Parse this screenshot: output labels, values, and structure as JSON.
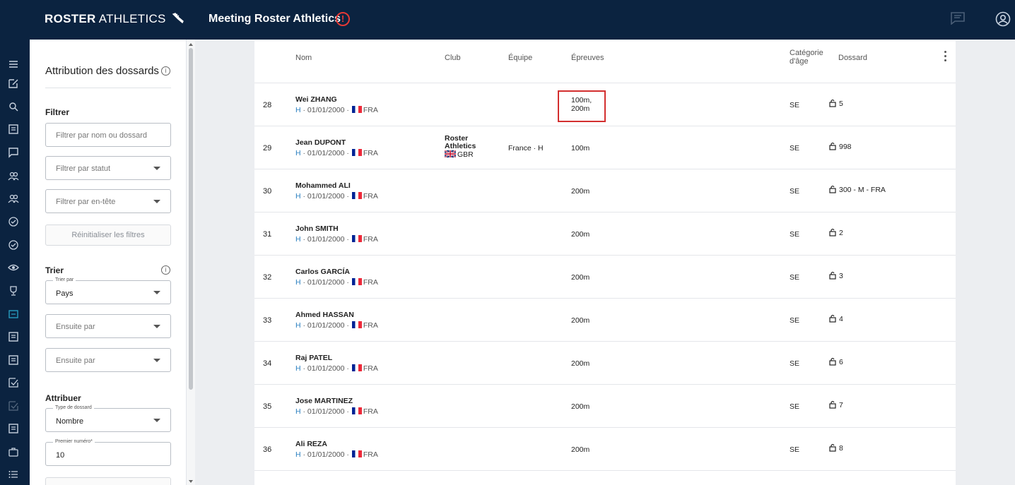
{
  "header": {
    "brand_bold": "ROSTER",
    "brand_light": "ATHLETICS",
    "meeting_title": "Meeting Roster Athletics",
    "warning_glyph": "!"
  },
  "rail": {
    "icons": [
      "menu-icon",
      "edit-icon",
      "search-icon",
      "list-icon",
      "chat-icon",
      "group-icon",
      "group-icon",
      "check-circle-icon",
      "check-circle-icon",
      "eye-icon",
      "trophy-icon",
      "bib-icon",
      "list-icon",
      "list-icon",
      "checkbox-icon",
      "checkbox-icon",
      "list-icon",
      "briefcase-icon",
      "bullet-list-icon"
    ],
    "active_color": "#2aa5c9"
  },
  "panel": {
    "title": "Attribution des dossards",
    "filter_label": "Filtrer",
    "filter_name_placeholder": "Filtrer par nom ou dossard",
    "filter_status_placeholder": "Filtrer par statut",
    "filter_header_placeholder": "Filtrer par en-tête",
    "reset_label": "Réinitialiser les filtres",
    "sort_label": "Trier",
    "sort_by_label": "Trier par",
    "sort_by_value": "Pays",
    "then_by_1": "Ensuite par",
    "then_by_2": "Ensuite par",
    "assign_label": "Attribuer",
    "bib_type_label": "Type de dossard",
    "bib_type_value": "Nombre",
    "first_number_label": "Premier numéro*",
    "first_number_value": "10"
  },
  "table": {
    "headers": {
      "name": "Nom",
      "club": "Club",
      "team": "Équipe",
      "events": "Épreuves",
      "age_1": "Catégorie",
      "age_2": "d'âge",
      "bib": "Dossard"
    },
    "rows": [
      {
        "num": "28",
        "name": "Wei ZHANG",
        "gender": "H",
        "dob": "· 01/01/2000 ·",
        "country": "FRA",
        "club": "",
        "club_country": "",
        "team": "",
        "events_1": "100m,",
        "events_2": "200m",
        "age": "SE",
        "bib": "5"
      },
      {
        "num": "29",
        "name": "Jean DUPONT",
        "gender": "H",
        "dob": "· 01/01/2000 ·",
        "country": "FRA",
        "club_1": "Roster",
        "club_2": "Athletics",
        "club_country": "GBR",
        "team": "France · H",
        "events": "100m",
        "age": "SE",
        "bib": "998"
      },
      {
        "num": "30",
        "name": "Mohammed ALI",
        "gender": "H",
        "dob": "· 01/01/2000 ·",
        "country": "FRA",
        "events": "200m",
        "age": "SE",
        "bib": "300 - M - FRA"
      },
      {
        "num": "31",
        "name": "John SMITH",
        "gender": "H",
        "dob": "· 01/01/2000 ·",
        "country": "FRA",
        "events": "200m",
        "age": "SE",
        "bib": "2"
      },
      {
        "num": "32",
        "name": "Carlos GARCÍA",
        "gender": "H",
        "dob": "· 01/01/2000 ·",
        "country": "FRA",
        "events": "200m",
        "age": "SE",
        "bib": "3"
      },
      {
        "num": "33",
        "name": "Ahmed HASSAN",
        "gender": "H",
        "dob": "· 01/01/2000 ·",
        "country": "FRA",
        "events": "200m",
        "age": "SE",
        "bib": "4"
      },
      {
        "num": "34",
        "name": "Raj PATEL",
        "gender": "H",
        "dob": "· 01/01/2000 ·",
        "country": "FRA",
        "events": "200m",
        "age": "SE",
        "bib": "6"
      },
      {
        "num": "35",
        "name": "Jose MARTINEZ",
        "gender": "H",
        "dob": "· 01/01/2000 ·",
        "country": "FRA",
        "events": "200m",
        "age": "SE",
        "bib": "7"
      },
      {
        "num": "36",
        "name": "Ali REZA",
        "gender": "H",
        "dob": "· 01/01/2000 ·",
        "country": "FRA",
        "events": "200m",
        "age": "SE",
        "bib": "8"
      }
    ]
  },
  "colors": {
    "topbar": "#0b2340",
    "warning": "#e53935",
    "highlight": "#d32f2f",
    "gender": "#2a7fc0"
  }
}
